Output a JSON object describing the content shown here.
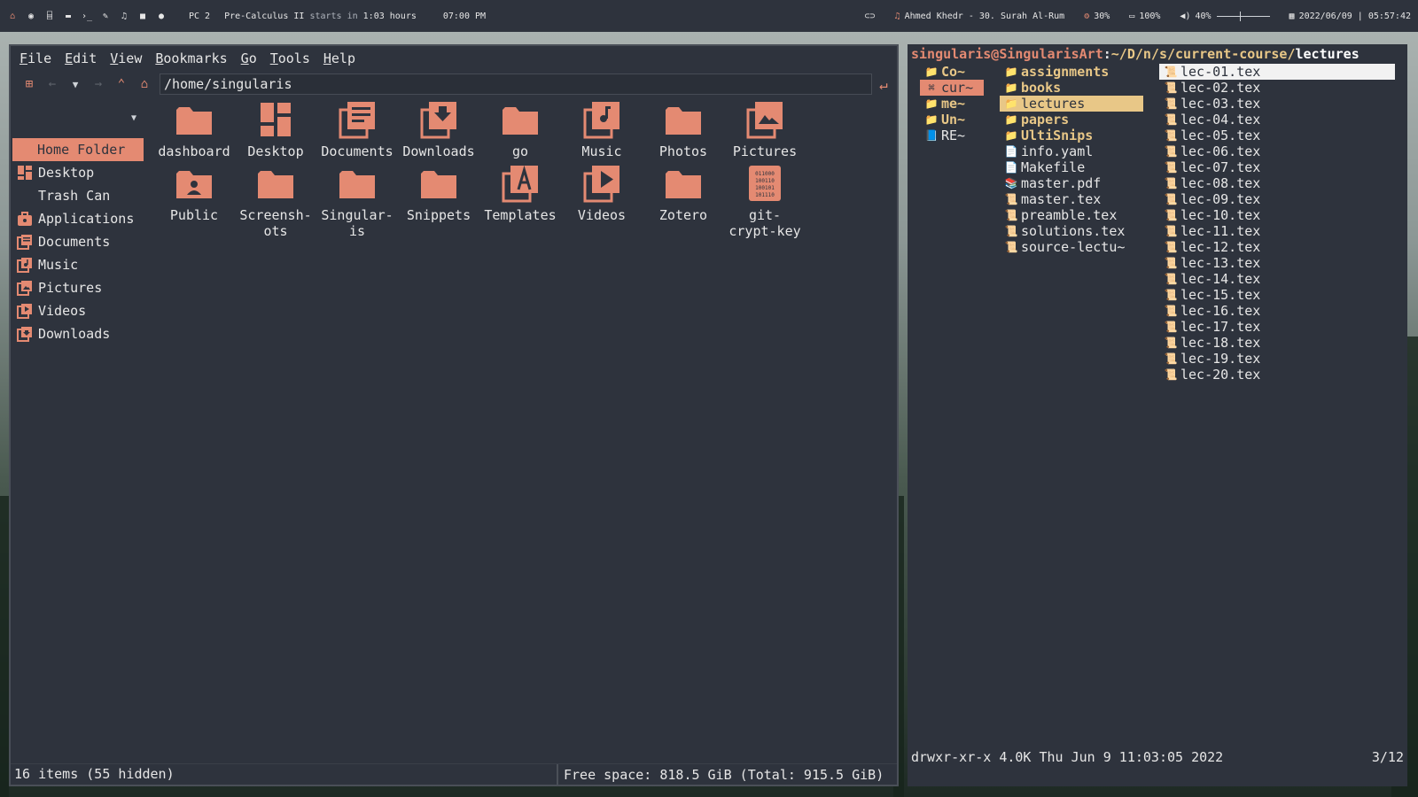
{
  "topbar": {
    "workspace": "PC 2",
    "event_name": "Pre-Calculus II",
    "event_mid": "starts in",
    "event_time": "1:03 hours",
    "clock_time": "07:00 PM",
    "music": "Ahmed Khedr - 30. Surah Al-Rum",
    "cpu": "30%",
    "battery": "100%",
    "volume": "40%",
    "volume_level": 0.4,
    "datetime": "2022/06/09 | 05:57:42",
    "launcher_icons": [
      "home-icon",
      "globe-icon",
      "bank-icon",
      "folder-icon",
      "terminal-icon",
      "edit-icon",
      "music-icon",
      "video-icon",
      "chat-icon"
    ]
  },
  "file_manager": {
    "menu": [
      "File",
      "Edit",
      "View",
      "Bookmarks",
      "Go",
      "Tools",
      "Help"
    ],
    "path": "/home/singularis",
    "sidebar": [
      {
        "label": "Home Folder",
        "icon": "home-icon",
        "selected": true
      },
      {
        "label": "Desktop",
        "icon": "desktop-icon"
      },
      {
        "label": "Trash Can",
        "icon": "trash-icon"
      },
      {
        "label": "Applications",
        "icon": "applications-icon"
      },
      {
        "label": "Documents",
        "icon": "documents-icon"
      },
      {
        "label": "Music",
        "icon": "music-icon"
      },
      {
        "label": "Pictures",
        "icon": "pictures-icon"
      },
      {
        "label": "Videos",
        "icon": "videos-icon"
      },
      {
        "label": "Downloads",
        "icon": "downloads-icon"
      }
    ],
    "items": [
      {
        "label": "dashboard",
        "icon": "folder"
      },
      {
        "label": "Desktop",
        "icon": "desktop"
      },
      {
        "label": "Documents",
        "icon": "documents"
      },
      {
        "label": "Downloads",
        "icon": "downloads"
      },
      {
        "label": "go",
        "icon": "folder"
      },
      {
        "label": "Music",
        "icon": "music"
      },
      {
        "label": "Photos",
        "icon": "folder"
      },
      {
        "label": "Pictures",
        "icon": "pictures"
      },
      {
        "label": "Public",
        "icon": "public"
      },
      {
        "label": "Screensh-\nots",
        "icon": "folder"
      },
      {
        "label": "Singular-\nis",
        "icon": "folder"
      },
      {
        "label": "Snippets",
        "icon": "folder"
      },
      {
        "label": "Templates",
        "icon": "templates"
      },
      {
        "label": "Videos",
        "icon": "videos"
      },
      {
        "label": "Zotero",
        "icon": "folder"
      },
      {
        "label": "git-\ncrypt-key",
        "icon": "binary"
      }
    ],
    "status_left": "16 items (55 hidden)",
    "status_right": "Free space: 818.5 GiB (Total: 915.5 GiB)"
  },
  "terminal": {
    "prompt_user": "singularis@SingularisArt",
    "prompt_colon": ":",
    "prompt_path": "~/D/n/s/current-course/",
    "prompt_last": "lectures",
    "col1": [
      {
        "label": "Co~",
        "glyph": "📁",
        "state": "dir"
      },
      {
        "label": "cur~",
        "glyph": "⌘",
        "state": "sel-cur"
      },
      {
        "label": "me~",
        "glyph": "📁",
        "state": "dir"
      },
      {
        "label": "Un~",
        "glyph": "📁",
        "state": "dir"
      },
      {
        "label": "RE~",
        "glyph": "📘",
        "state": "file"
      }
    ],
    "col2": [
      {
        "label": "assignments",
        "glyph": "📁",
        "state": "dir"
      },
      {
        "label": "books",
        "glyph": "📁",
        "state": "dir"
      },
      {
        "label": "lectures",
        "glyph": "📁",
        "state": "sel-dir"
      },
      {
        "label": "papers",
        "glyph": "📁",
        "state": "dir"
      },
      {
        "label": "UltiSnips",
        "glyph": "📁",
        "state": "dir"
      },
      {
        "label": "info.yaml",
        "glyph": "📄",
        "state": "file"
      },
      {
        "label": "Makefile",
        "glyph": "📄",
        "state": "file"
      },
      {
        "label": "master.pdf",
        "glyph": "📚",
        "state": "file"
      },
      {
        "label": "master.tex",
        "glyph": "📜",
        "state": "file"
      },
      {
        "label": "preamble.tex",
        "glyph": "📜",
        "state": "file"
      },
      {
        "label": "solutions.tex",
        "glyph": "📜",
        "state": "file"
      },
      {
        "label": "source-lectu~",
        "glyph": "📜",
        "state": "file"
      }
    ],
    "col3": [
      {
        "label": "lec-01.tex",
        "glyph": "📜",
        "state": "sel-file"
      },
      {
        "label": "lec-02.tex",
        "glyph": "📜",
        "state": "file"
      },
      {
        "label": "lec-03.tex",
        "glyph": "📜",
        "state": "file"
      },
      {
        "label": "lec-04.tex",
        "glyph": "📜",
        "state": "file"
      },
      {
        "label": "lec-05.tex",
        "glyph": "📜",
        "state": "file"
      },
      {
        "label": "lec-06.tex",
        "glyph": "📜",
        "state": "file"
      },
      {
        "label": "lec-07.tex",
        "glyph": "📜",
        "state": "file"
      },
      {
        "label": "lec-08.tex",
        "glyph": "📜",
        "state": "file"
      },
      {
        "label": "lec-09.tex",
        "glyph": "📜",
        "state": "file"
      },
      {
        "label": "lec-10.tex",
        "glyph": "📜",
        "state": "file"
      },
      {
        "label": "lec-11.tex",
        "glyph": "📜",
        "state": "file"
      },
      {
        "label": "lec-12.tex",
        "glyph": "📜",
        "state": "file"
      },
      {
        "label": "lec-13.tex",
        "glyph": "📜",
        "state": "file"
      },
      {
        "label": "lec-14.tex",
        "glyph": "📜",
        "state": "file"
      },
      {
        "label": "lec-15.tex",
        "glyph": "📜",
        "state": "file"
      },
      {
        "label": "lec-16.tex",
        "glyph": "📜",
        "state": "file"
      },
      {
        "label": "lec-17.tex",
        "glyph": "📜",
        "state": "file"
      },
      {
        "label": "lec-18.tex",
        "glyph": "📜",
        "state": "file"
      },
      {
        "label": "lec-19.tex",
        "glyph": "📜",
        "state": "file"
      },
      {
        "label": "lec-20.tex",
        "glyph": "📜",
        "state": "file"
      }
    ],
    "footer_left": "drwxr-xr-x 4.0K Thu Jun  9 11:03:05 2022",
    "footer_right": "3/12"
  },
  "colors": {
    "accent": "#e48a72",
    "dir": "#e8c787",
    "panel": "#2e333d"
  }
}
